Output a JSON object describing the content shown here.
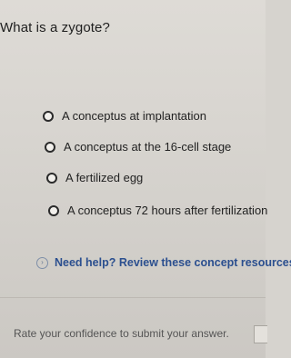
{
  "question": {
    "text": "What is a zygote?"
  },
  "options": [
    {
      "label": "A conceptus at implantation"
    },
    {
      "label": "A conceptus at the 16-cell stage"
    },
    {
      "label": "A fertilized egg"
    },
    {
      "label": "A conceptus 72 hours after fertilization"
    }
  ],
  "help": {
    "label": "Need help? Review these concept resources."
  },
  "confidence": {
    "label": "Rate your confidence to submit your answer."
  },
  "colors": {
    "link": "#2b4f8f",
    "background": "#d6d3ce"
  }
}
